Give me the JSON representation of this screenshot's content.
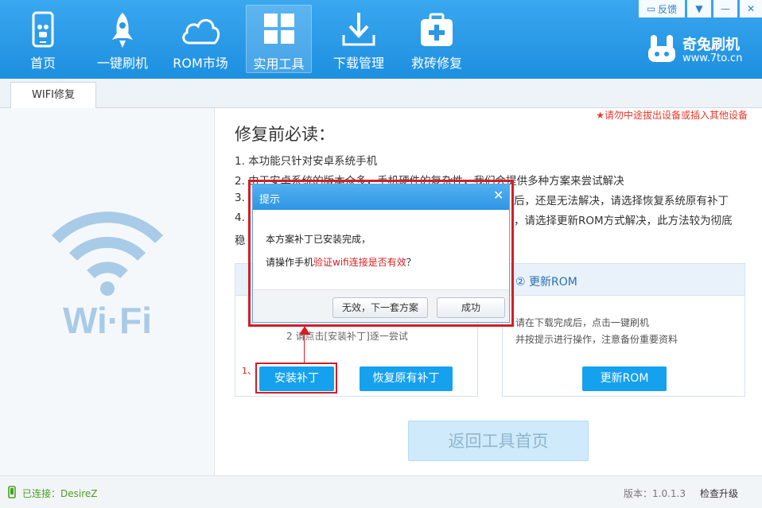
{
  "header": {
    "nav": [
      {
        "label": "首页",
        "icon": "phone-icon"
      },
      {
        "label": "一键刷机",
        "icon": "rocket-icon"
      },
      {
        "label": "ROM市场",
        "icon": "cloud-icon"
      },
      {
        "label": "实用工具",
        "icon": "grid-icon"
      },
      {
        "label": "下载管理",
        "icon": "download-icon"
      },
      {
        "label": "救砖修复",
        "icon": "medkit-icon"
      }
    ],
    "feedback": "反馈",
    "brand_name": "奇兔刷机",
    "brand_url": "www.7to.cn"
  },
  "tabs": [
    {
      "label": "WIFI修复"
    }
  ],
  "left": {
    "logo_text": "Wi·Fi"
  },
  "main": {
    "warning": "★请勿中途拔出设备或插入其他设备",
    "title": "修复前必读：",
    "lines": [
      "1. 本功能只针对安卓系统手机",
      "2. 由于安卓系统的版本众多，手机硬件的复杂性，我们会提供多种方案来尝试解决",
      "3.",
      "后，还是无法解决，请选择恢复系统原有补丁",
      "4.",
      "，请选择更新ROM方式解决，此方法较为彻底",
      "稳"
    ],
    "panel_left": {
      "hint": "2 请点击[安装补丁]逐一尝试",
      "step_marker": "1、",
      "install_button": "安装补丁",
      "restore_button": "恢复原有补丁"
    },
    "panel_right": {
      "header": "② 更新ROM",
      "desc1": "请在下载完成后，点击一键刷机",
      "desc2": "并按提示进行操作，注意备份重要资料",
      "update_button": "更新ROM"
    },
    "back_button": "返回工具首页"
  },
  "dialog": {
    "title": "提示",
    "close": "✕",
    "msg1": "本方案补丁已安装完成，",
    "msg2_prefix": "请操作手机",
    "msg2_highlight": "验证wifi连接是否有效",
    "msg2_suffix": "？",
    "btn_next": "无效，下一套方案",
    "btn_ok": "成功"
  },
  "status": {
    "connection": "已连接：DesireZ",
    "version": "版本：1.0.1.3",
    "upgrade": "检查升级"
  },
  "colors": {
    "header_blue": "#1d8fe0",
    "button_blue": "#16a1ef",
    "annotation_red": "#d41d24",
    "connected_green": "#47a11d"
  }
}
